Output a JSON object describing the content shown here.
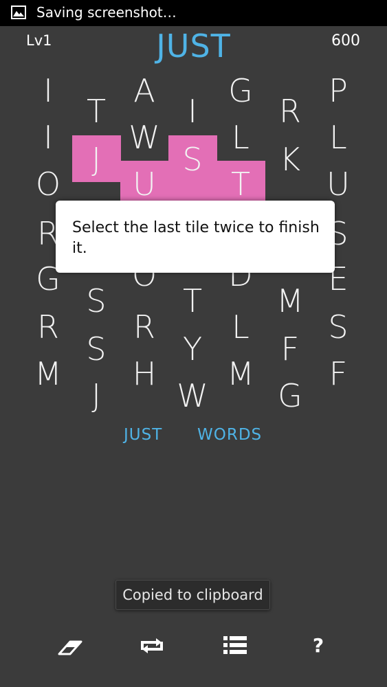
{
  "status_bar": {
    "text": "Saving screenshot…",
    "icon": "image-icon"
  },
  "header": {
    "level": "Lv1",
    "current_word": "JUST",
    "score": "600"
  },
  "grid": {
    "letters": [
      {
        "ch": "I"
      },
      {
        "ch": "A"
      },
      {
        "ch": "G"
      },
      {
        "ch": "P"
      },
      {
        "ch": "T"
      },
      {
        "ch": "I"
      },
      {
        "ch": "R"
      },
      {
        "ch": "I"
      },
      {
        "ch": "W"
      },
      {
        "ch": "L"
      },
      {
        "ch": "L"
      },
      {
        "ch": "J"
      },
      {
        "ch": "S"
      },
      {
        "ch": "K"
      },
      {
        "ch": "O"
      },
      {
        "ch": "U"
      },
      {
        "ch": "T"
      },
      {
        "ch": "U"
      },
      {
        "ch": "R"
      },
      {
        "ch": "S"
      },
      {
        "ch": "G"
      },
      {
        "ch": "O"
      },
      {
        "ch": "D"
      },
      {
        "ch": "E"
      },
      {
        "ch": "S"
      },
      {
        "ch": "T"
      },
      {
        "ch": "M"
      },
      {
        "ch": "R"
      },
      {
        "ch": "R"
      },
      {
        "ch": "L"
      },
      {
        "ch": "S"
      },
      {
        "ch": "S"
      },
      {
        "ch": "Y"
      },
      {
        "ch": "F"
      },
      {
        "ch": "M"
      },
      {
        "ch": "H"
      },
      {
        "ch": "M"
      },
      {
        "ch": "F"
      },
      {
        "ch": "J"
      },
      {
        "ch": "W"
      },
      {
        "ch": "G"
      }
    ],
    "highlight_color": "#e36fb6"
  },
  "popup": {
    "message": "Select the last tile twice to finish it."
  },
  "found_words": [
    "JUST",
    "WORDS"
  ],
  "toast": {
    "text": "Copied to clipboard"
  },
  "toolbar": {
    "buttons": [
      {
        "icon": "eraser-icon"
      },
      {
        "icon": "shuffle-icon"
      },
      {
        "icon": "list-icon"
      },
      {
        "icon": "help-icon",
        "glyph": "?"
      }
    ]
  },
  "colors": {
    "accent": "#4fb3e6",
    "background": "#3b3b3b"
  }
}
